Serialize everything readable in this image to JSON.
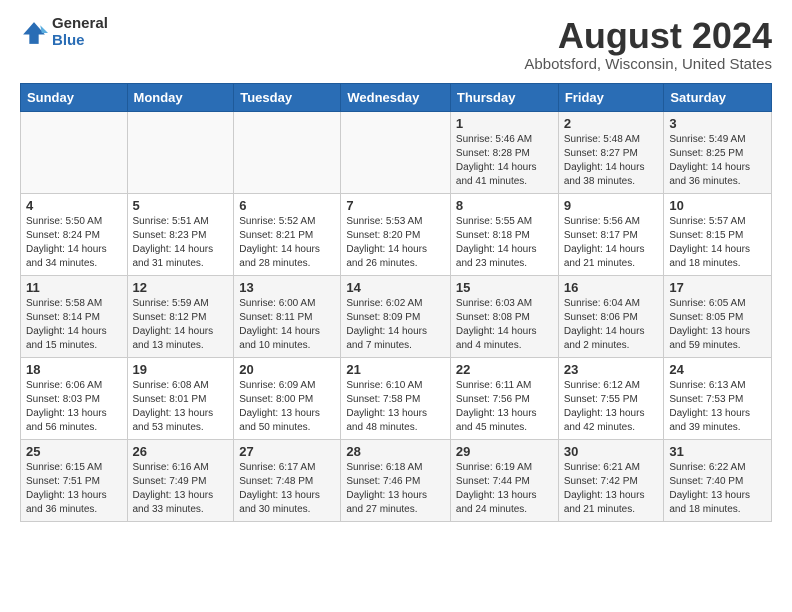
{
  "header": {
    "logo_general": "General",
    "logo_blue": "Blue",
    "month_year": "August 2024",
    "location": "Abbotsford, Wisconsin, United States"
  },
  "weekdays": [
    "Sunday",
    "Monday",
    "Tuesday",
    "Wednesday",
    "Thursday",
    "Friday",
    "Saturday"
  ],
  "weeks": [
    [
      {
        "day": "",
        "info": ""
      },
      {
        "day": "",
        "info": ""
      },
      {
        "day": "",
        "info": ""
      },
      {
        "day": "",
        "info": ""
      },
      {
        "day": "1",
        "info": "Sunrise: 5:46 AM\nSunset: 8:28 PM\nDaylight: 14 hours\nand 41 minutes."
      },
      {
        "day": "2",
        "info": "Sunrise: 5:48 AM\nSunset: 8:27 PM\nDaylight: 14 hours\nand 38 minutes."
      },
      {
        "day": "3",
        "info": "Sunrise: 5:49 AM\nSunset: 8:25 PM\nDaylight: 14 hours\nand 36 minutes."
      }
    ],
    [
      {
        "day": "4",
        "info": "Sunrise: 5:50 AM\nSunset: 8:24 PM\nDaylight: 14 hours\nand 34 minutes."
      },
      {
        "day": "5",
        "info": "Sunrise: 5:51 AM\nSunset: 8:23 PM\nDaylight: 14 hours\nand 31 minutes."
      },
      {
        "day": "6",
        "info": "Sunrise: 5:52 AM\nSunset: 8:21 PM\nDaylight: 14 hours\nand 28 minutes."
      },
      {
        "day": "7",
        "info": "Sunrise: 5:53 AM\nSunset: 8:20 PM\nDaylight: 14 hours\nand 26 minutes."
      },
      {
        "day": "8",
        "info": "Sunrise: 5:55 AM\nSunset: 8:18 PM\nDaylight: 14 hours\nand 23 minutes."
      },
      {
        "day": "9",
        "info": "Sunrise: 5:56 AM\nSunset: 8:17 PM\nDaylight: 14 hours\nand 21 minutes."
      },
      {
        "day": "10",
        "info": "Sunrise: 5:57 AM\nSunset: 8:15 PM\nDaylight: 14 hours\nand 18 minutes."
      }
    ],
    [
      {
        "day": "11",
        "info": "Sunrise: 5:58 AM\nSunset: 8:14 PM\nDaylight: 14 hours\nand 15 minutes."
      },
      {
        "day": "12",
        "info": "Sunrise: 5:59 AM\nSunset: 8:12 PM\nDaylight: 14 hours\nand 13 minutes."
      },
      {
        "day": "13",
        "info": "Sunrise: 6:00 AM\nSunset: 8:11 PM\nDaylight: 14 hours\nand 10 minutes."
      },
      {
        "day": "14",
        "info": "Sunrise: 6:02 AM\nSunset: 8:09 PM\nDaylight: 14 hours\nand 7 minutes."
      },
      {
        "day": "15",
        "info": "Sunrise: 6:03 AM\nSunset: 8:08 PM\nDaylight: 14 hours\nand 4 minutes."
      },
      {
        "day": "16",
        "info": "Sunrise: 6:04 AM\nSunset: 8:06 PM\nDaylight: 14 hours\nand 2 minutes."
      },
      {
        "day": "17",
        "info": "Sunrise: 6:05 AM\nSunset: 8:05 PM\nDaylight: 13 hours\nand 59 minutes."
      }
    ],
    [
      {
        "day": "18",
        "info": "Sunrise: 6:06 AM\nSunset: 8:03 PM\nDaylight: 13 hours\nand 56 minutes."
      },
      {
        "day": "19",
        "info": "Sunrise: 6:08 AM\nSunset: 8:01 PM\nDaylight: 13 hours\nand 53 minutes."
      },
      {
        "day": "20",
        "info": "Sunrise: 6:09 AM\nSunset: 8:00 PM\nDaylight: 13 hours\nand 50 minutes."
      },
      {
        "day": "21",
        "info": "Sunrise: 6:10 AM\nSunset: 7:58 PM\nDaylight: 13 hours\nand 48 minutes."
      },
      {
        "day": "22",
        "info": "Sunrise: 6:11 AM\nSunset: 7:56 PM\nDaylight: 13 hours\nand 45 minutes."
      },
      {
        "day": "23",
        "info": "Sunrise: 6:12 AM\nSunset: 7:55 PM\nDaylight: 13 hours\nand 42 minutes."
      },
      {
        "day": "24",
        "info": "Sunrise: 6:13 AM\nSunset: 7:53 PM\nDaylight: 13 hours\nand 39 minutes."
      }
    ],
    [
      {
        "day": "25",
        "info": "Sunrise: 6:15 AM\nSunset: 7:51 PM\nDaylight: 13 hours\nand 36 minutes."
      },
      {
        "day": "26",
        "info": "Sunrise: 6:16 AM\nSunset: 7:49 PM\nDaylight: 13 hours\nand 33 minutes."
      },
      {
        "day": "27",
        "info": "Sunrise: 6:17 AM\nSunset: 7:48 PM\nDaylight: 13 hours\nand 30 minutes."
      },
      {
        "day": "28",
        "info": "Sunrise: 6:18 AM\nSunset: 7:46 PM\nDaylight: 13 hours\nand 27 minutes."
      },
      {
        "day": "29",
        "info": "Sunrise: 6:19 AM\nSunset: 7:44 PM\nDaylight: 13 hours\nand 24 minutes."
      },
      {
        "day": "30",
        "info": "Sunrise: 6:21 AM\nSunset: 7:42 PM\nDaylight: 13 hours\nand 21 minutes."
      },
      {
        "day": "31",
        "info": "Sunrise: 6:22 AM\nSunset: 7:40 PM\nDaylight: 13 hours\nand 18 minutes."
      }
    ]
  ]
}
